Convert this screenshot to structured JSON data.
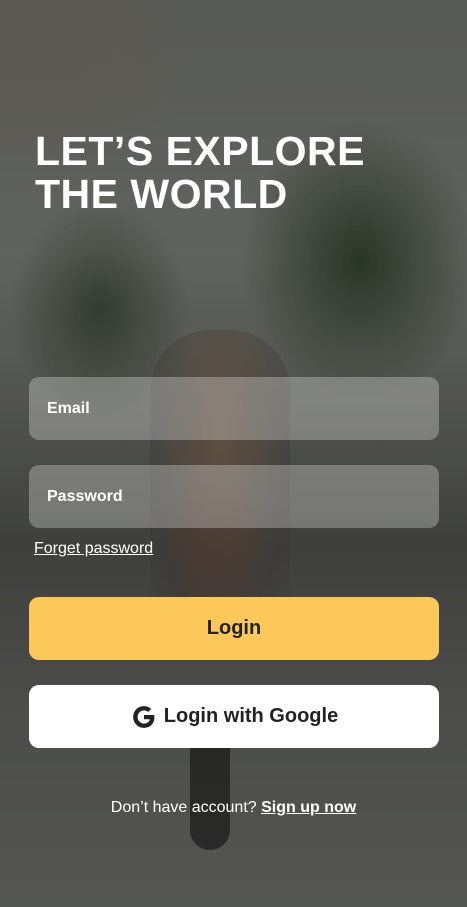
{
  "hero": {
    "title_line1": "LET’S EXPLORE",
    "title_line2": "THE WORLD"
  },
  "form": {
    "email_placeholder": "Email",
    "password_placeholder": "Password",
    "forgot_label": "Forget password"
  },
  "buttons": {
    "login_label": "Login",
    "google_label": "Login with Google",
    "google_icon": "google-g-icon"
  },
  "footer": {
    "prompt": "Don’t have account?",
    "signup_label": "Sign up now"
  },
  "colors": {
    "accent": "#fcc85a",
    "field_bg": "rgba(255,255,255,0.28)",
    "text_light": "#ffffff",
    "text_dark": "#222222"
  }
}
